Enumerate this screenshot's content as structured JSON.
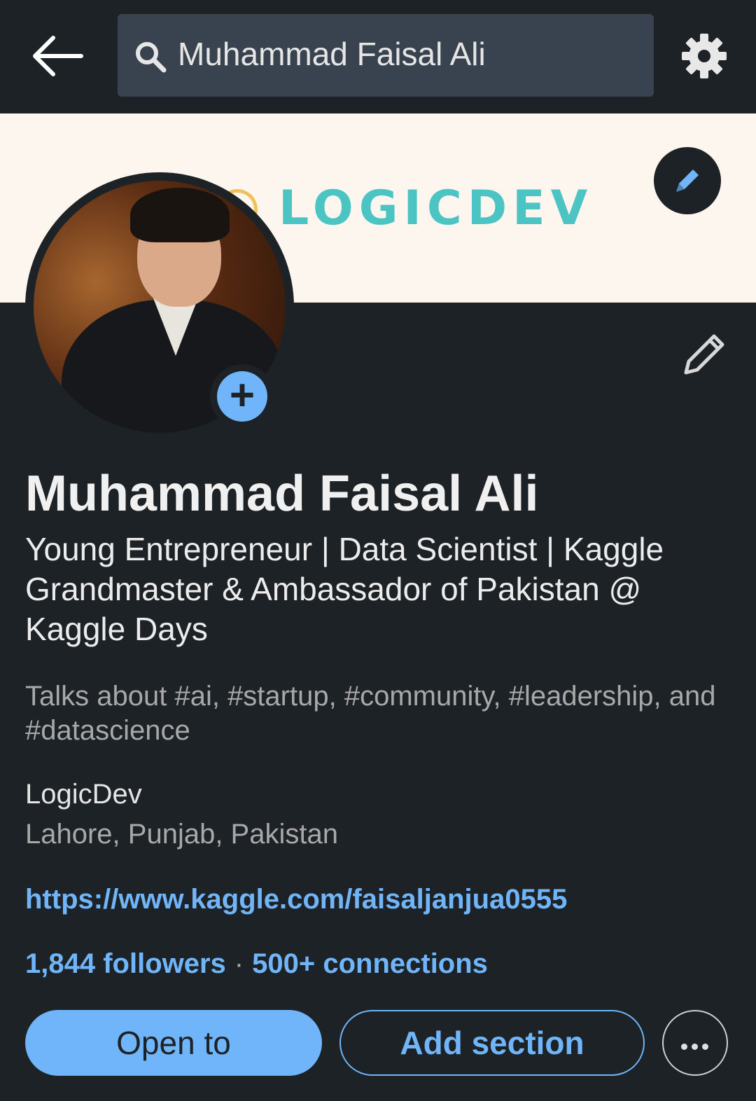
{
  "search": {
    "query": "Muhammad Faisal Ali"
  },
  "banner": {
    "logo_text": "LOGICDEV"
  },
  "profile": {
    "name": "Muhammad Faisal Ali",
    "headline": "Young Entrepreneur | Data Scientist | Kaggle Grandmaster & Ambassador of Pakistan @ Kaggle Days",
    "talks_about": "Talks about #ai, #startup, #community, #leadership, and #datascience",
    "company": "LogicDev",
    "location": "Lahore, Punjab, Pakistan",
    "link": "https://www.kaggle.com/faisaljanjua0555",
    "followers": "1,844 followers",
    "separator": "·",
    "connections": "500+ connections"
  },
  "actions": {
    "open_to_label": "Open to",
    "add_section_label": "Add section"
  },
  "colors": {
    "background": "#1d2226",
    "accent": "#70b5f9",
    "search_bg": "#38434f",
    "banner_bg": "#fdf6ef"
  },
  "icons": {
    "back": "arrow-left-icon",
    "search": "search-icon",
    "settings": "gear-icon",
    "edit_banner": "pencil-icon",
    "edit_intro": "pencil-icon",
    "add_photo": "plus-icon",
    "more": "more-horizontal-icon"
  }
}
